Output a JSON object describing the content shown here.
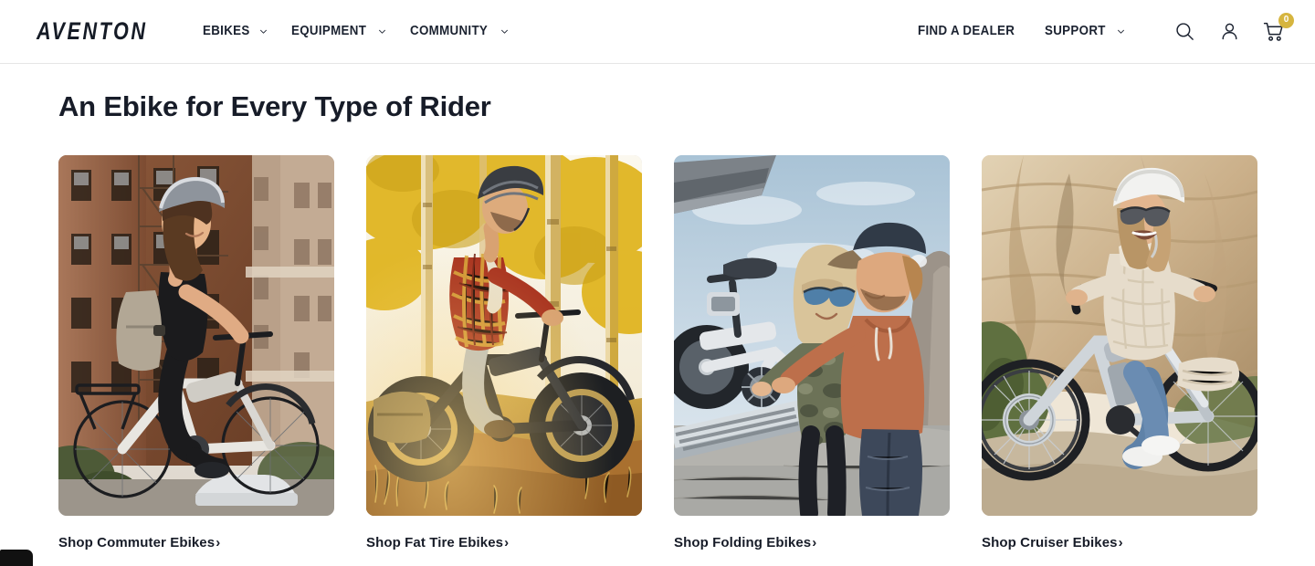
{
  "header": {
    "brand": "AVENTON",
    "nav_primary": [
      {
        "label": "EBIKES",
        "has_dropdown": true,
        "icon": "chevron-down-icon"
      },
      {
        "label": "EQUIPMENT",
        "has_dropdown": true,
        "icon": "chevron-down-icon"
      },
      {
        "label": "COMMUNITY",
        "has_dropdown": true,
        "icon": "chevron-down-icon"
      }
    ],
    "nav_secondary": [
      {
        "label": "FIND A DEALER",
        "has_dropdown": false
      },
      {
        "label": "SUPPORT",
        "has_dropdown": true,
        "icon": "chevron-down-icon"
      }
    ],
    "icons": [
      {
        "name": "search-icon",
        "label": "Search"
      },
      {
        "name": "account-icon",
        "label": "Account"
      },
      {
        "name": "cart-icon",
        "label": "Cart"
      }
    ],
    "cart_count": "0",
    "cart_badge_color": "#d6b53f",
    "border_color": "#e6e6e6"
  },
  "main": {
    "title": "An Ebike for Every Type of Rider",
    "cards": [
      {
        "link_label": "Shop Commuter Ebikes",
        "arrow": "›",
        "image_alt": "Smiling woman with backpack and helmet riding a white commuter ebike past red brick city buildings",
        "palette": {
          "sky": "#e9e5df",
          "building": "#8e5a3c",
          "building_dark": "#6b3f27",
          "building_light": "#b08a6a",
          "skin": "#e0ab84",
          "hair": "#5a3a22",
          "clothing": "#1b1b1d",
          "backpack": "#b2a795",
          "bike": "#e8e6e1",
          "foliage": "#4d5a37"
        }
      },
      {
        "link_label": "Shop Fat Tire Ebikes",
        "arrow": "›",
        "image_alt": "Man in red plaid flannel riding a fat tire ebike on a dirt trail among golden aspen trees",
        "palette": {
          "sky": "#f6f2e6",
          "trees": "#e0b521",
          "trunk": "#cfa93f",
          "ground": "#a9702f",
          "grass": "#c9a243",
          "plaid_red": "#a8321f",
          "plaid_yellow": "#d9a83a",
          "jeans": "#b9bfc4",
          "bike": "#23252a",
          "helmet": "#3a3d42"
        }
      },
      {
        "link_label": "Shop Folding Ebikes",
        "arrow": "›",
        "image_alt": "Couple lifting a folding ebike off a truck tailgate under a blue sky by the shore",
        "palette": {
          "sky": "#b9cedd",
          "sky_light": "#dbe6ee",
          "awning": "#7c8288",
          "ground": "#a9a9a5",
          "jacket_rust": "#bd6f4b",
          "camo": "#6c7257",
          "cap": "#303a47",
          "bike": "#e4e7ea",
          "rock": "#9c9389",
          "jeans": "#3d485a"
        }
      },
      {
        "link_label": "Shop Cruiser Ebikes",
        "arrow": "›",
        "image_alt": "Laughing woman in cream sweater and white helmet riding a cruiser ebike in front of sandstone cliffs",
        "palette": {
          "sky": "#efe6d6",
          "cliff": "#cbb08a",
          "cliff_dark": "#a88c66",
          "cliff_light": "#e2d2b4",
          "shrub": "#5f7040",
          "sweater": "#e6dccb",
          "jeans": "#5f82a8",
          "helmet": "#f2f2f0",
          "bike": "#cfd5da",
          "path": "#c7b89e"
        }
      }
    ]
  },
  "widgets": {
    "corner_nub_color": "#111111"
  }
}
